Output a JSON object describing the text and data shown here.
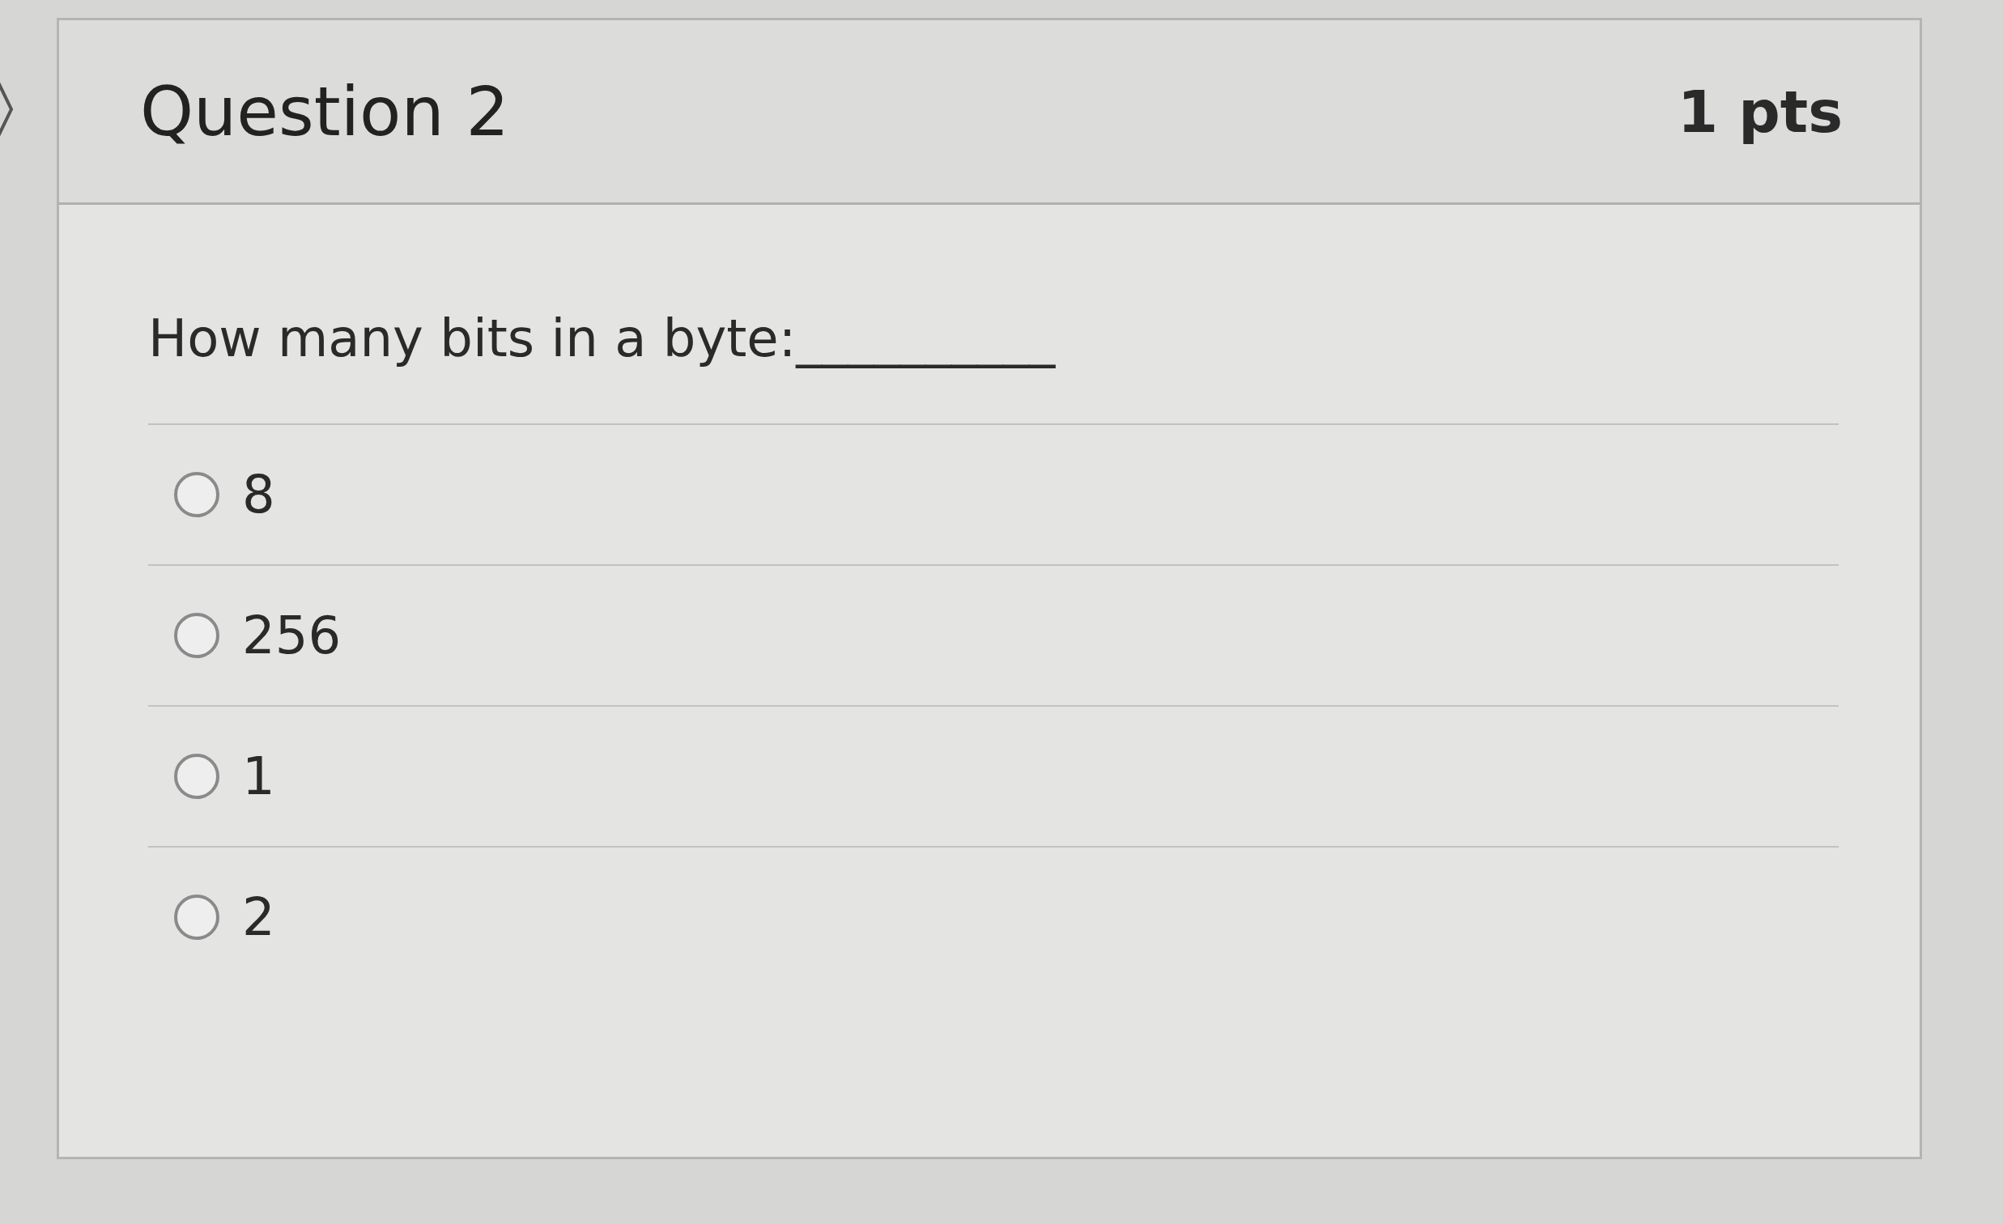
{
  "question": {
    "title": "Question 2",
    "points": "1 pts"
  },
  "prompt": "How many bits in a byte:__________",
  "options": [
    {
      "label": "8",
      "selected": false
    },
    {
      "label": "256",
      "selected": false
    },
    {
      "label": "1",
      "selected": false
    },
    {
      "label": "2",
      "selected": false
    }
  ]
}
